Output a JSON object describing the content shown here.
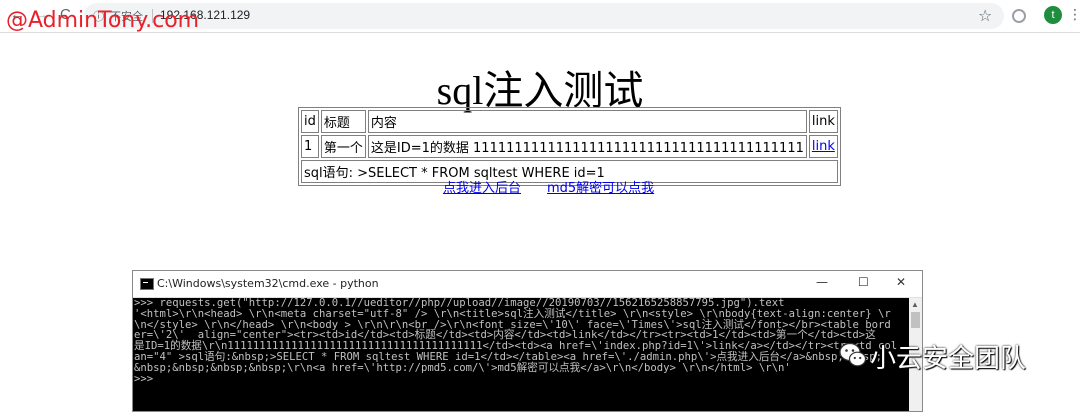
{
  "browser": {
    "nav": {
      "back": "←",
      "forward": "→",
      "reload": "C"
    },
    "address": {
      "security_label": "不安全",
      "url": "192.168.121.129"
    },
    "avatar_letter": "t"
  },
  "watermark_top_left": "@AdminTony.com",
  "page": {
    "title": "sql注入测试",
    "table": {
      "headers": [
        "id",
        "标题",
        "内容",
        "link"
      ],
      "row": {
        "id": "1",
        "title": "第一个",
        "content": "这是ID=1的数据 1111111111111111111111111111111111111111",
        "link": "link"
      },
      "sql_row": "sql语句: >SELECT * FROM sqltest WHERE id=1"
    },
    "links": {
      "admin": "点我进入后台",
      "md5": "md5解密可以点我"
    }
  },
  "cmd": {
    "title": "C:\\Windows\\system32\\cmd.exe - python",
    "controls": {
      "minimize": "—",
      "maximize": "☐",
      "close": "✕"
    },
    "lines": [
      ">>> requests.get(\"http://127.0.0.1//ueditor//php//upload//image//20190703//1562165258857795.jpg\").text",
      "'<html>\\r\\n<head> \\r\\n<meta charset=\"utf-8\" /> \\r\\n<title>sql注入测试</title> \\r\\n<style> \\r\\nbody{text-align:center} \\r",
      "\\n</style> \\r\\n</head> \\r\\n<body > \\r\\n\\r\\n<br />\\r\\n<font size=\\'10\\' face=\\'Times\\'>sql注入测试</font></br><table bord",
      "er=\\'2\\'  align=\"center\"><tr><td>id</td><td>标题</td><td>内容</td><td>link</td></tr><tr><td>1</td><td>第一个</td><td>这",
      "是ID=1的数据\\r\\n1111111111111111111111111111111111111111</td><td><a href=\\'index.php?id=1\\'>link</a></td></tr><tr><td col",
      "an=\"4\" >sql语句:&nbsp;>SELECT * FROM sqltest WHERE id=1</td></table><a href=\\'./admin.php\\'>点我进入后台</a>&nbsp;&nbsp;",
      "&nbsp;&nbsp;&nbsp;&nbsp;\\r\\n<a href=\\'http://pmd5.com/\\'>md5解密可以点我</a>\\r\\n</body> \\r\\n</html> \\r\\n'",
      ">>>"
    ]
  },
  "watermark_bottom_right": "小云安全团队",
  "colors": {
    "watermark_red": "#e8202a",
    "link_blue": "#0000ee",
    "console_text": "#c0c0c0"
  },
  "icons": [
    "back-arrow-icon",
    "forward-arrow-icon",
    "reload-icon",
    "info-icon",
    "star-icon",
    "extension-icon",
    "more-menu-icon",
    "cmd-icon",
    "wechat-icon"
  ]
}
